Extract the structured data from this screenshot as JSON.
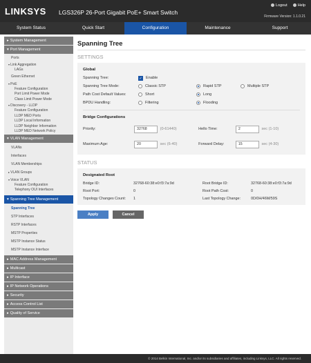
{
  "header": {
    "brand": "LINKSYS",
    "product": "LGS326P 26-Port Gigabit PoE+ Smart Switch",
    "logout": "Logout",
    "help": "Help",
    "firmware": "Firmware Version: 1.1.0.21"
  },
  "tabs": [
    "System Status",
    "Quick Start",
    "Configuration",
    "Maintenance",
    "Support"
  ],
  "sidebar": {
    "system_management": "System Management",
    "port_management": "Port Management",
    "ports": "Ports",
    "link_aggregation": "Link Aggregation",
    "lags": "LAGs",
    "green_ethernet": "Green Ethernet",
    "poe": "PoE",
    "feature_configuration": "Feature Configuration",
    "port_limit_power_mode": "Port Limit Power Mode",
    "class_limit_power_mode": "Class Limit Power Mode",
    "discovery_lldp": "Discovery - LLDP",
    "lldp_feature_configuration": "Feature Configuration",
    "lldp_med_ports": "LLDP MED Ports",
    "lldp_local_information": "LLDP Local Information",
    "lldp_neighbor_information": "LLDP Neighbor Information",
    "lldp_med_network_policy": "LLDP MED Network Policy",
    "vlan_management": "VLAN Management",
    "vlans": "VLANs",
    "interfaces": "Interfaces",
    "vlan_memberships": "VLAN Memberships",
    "vlan_groups": "VLAN Groups",
    "voice_vlan": "Voice VLAN",
    "voice_feature_configuration": "Feature Configuration",
    "telephony_oui": "Telephony OUI Interfaces",
    "spanning_tree_management": "Spanning Tree Management",
    "spanning_tree": "Spanning Tree",
    "stp_interfaces": "STP Interfaces",
    "rstp_interfaces": "RSTP Interfaces",
    "mstp_properties": "MSTP Properties",
    "mstp_instance_status": "MSTP Instance Status",
    "mstp_instance_interface": "MSTP Instance Interface",
    "mac_address_management": "MAC Address Management",
    "multicast": "Multicast",
    "ip_interface": "IP Interface",
    "ip_network_operations": "IP Network Operations",
    "security": "Security",
    "access_control_list": "Access Control List",
    "quality_of_service": "Quality of Service"
  },
  "main": {
    "title": "Spanning Tree",
    "settings_label": "SETTINGS",
    "global_label": "Global",
    "stp_label": "Spanning Tree:",
    "stp_enable": "Enable",
    "mode_label": "Spanning Tree Mode:",
    "mode_classic": "Classic STP",
    "mode_rapid": "Rapid STP",
    "mode_multiple": "Multiple STP",
    "path_label": "Path Cost Default Values:",
    "path_short": "Short",
    "path_long": "Long",
    "bpdu_label": "BPDU Handling:",
    "bpdu_filtering": "Filtering",
    "bpdu_flooding": "Flooding",
    "bridge_label": "Bridge Configurations",
    "priority_label": "Priority:",
    "priority_value": "32768",
    "priority_range": "(0-61440)",
    "hello_label": "Hello Time:",
    "hello_value": "2",
    "hello_range": "sec (1-10)",
    "maxage_label": "Maximum Age:",
    "maxage_value": "20",
    "maxage_range": "sec (6-40)",
    "fwd_label": "Forward Delay:",
    "fwd_value": "15",
    "fwd_range": "sec (4-30)",
    "status_label": "STATUS",
    "designated_label": "Designated Root",
    "bridge_id_label": "Bridge ID:",
    "bridge_id_value": "32768-60:38:e0:f3:7a:9d",
    "root_bridge_label": "Root Bridge ID:",
    "root_bridge_value": "32768-60:38:e0:f3:7a:9d",
    "root_port_label": "Root Port:",
    "root_port_value": "0",
    "root_path_label": "Root Path Cost:",
    "root_path_value": "0",
    "topo_count_label": "Topology Changes Count:",
    "topo_count_value": "1",
    "last_topo_label": "Last Topology Change:",
    "last_topo_value": "0D/0H/46M/59S",
    "apply": "Apply",
    "cancel": "Cancel"
  },
  "footer": "© 2014 Belkin International, Inc. and/or its subsidiaries and affiliates, including Linksys, LLC. All rights reserved."
}
